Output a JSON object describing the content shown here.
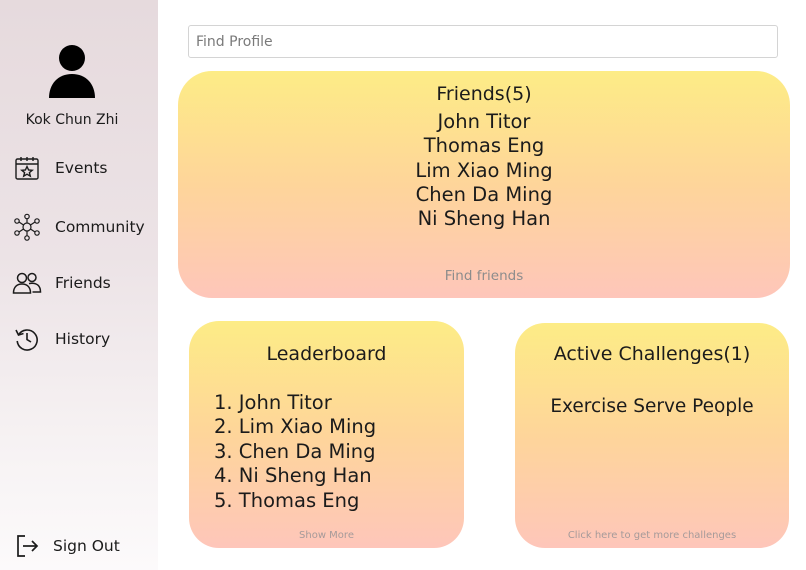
{
  "sidebar": {
    "user_name": "Kok Chun Zhi",
    "avatar_icon": "user-avatar-icon",
    "items": [
      {
        "label": "Events",
        "icon": "calendar-star-icon"
      },
      {
        "label": "Community",
        "icon": "network-icon"
      },
      {
        "label": "Friends",
        "icon": "people-icon"
      },
      {
        "label": "History",
        "icon": "history-icon"
      }
    ],
    "signout": {
      "label": "Sign Out",
      "icon": "sign-out-icon"
    }
  },
  "search": {
    "placeholder": "Find Profile",
    "value": ""
  },
  "friends": {
    "title": "Friends(5)",
    "names": [
      "John Titor",
      "Thomas Eng",
      "Lim Xiao Ming",
      "Chen Da Ming",
      "Ni Sheng Han"
    ],
    "find_label": "Find friends"
  },
  "leaderboard": {
    "title": "Leaderboard",
    "entries": [
      "1. John Titor",
      "2. Lim Xiao Ming",
      "3. Chen Da Ming",
      "4. Ni Sheng Han",
      "5. Thomas Eng"
    ],
    "show_more": "Show More"
  },
  "challenges": {
    "title": "Active Challenges(1)",
    "items": [
      "Exercise Serve People"
    ],
    "more_label": "Click here to get more challenges"
  },
  "colors": {
    "card_top": "#fdec86",
    "card_bottom": "#fec6ba",
    "sidebar_top": "#e6dadd"
  }
}
